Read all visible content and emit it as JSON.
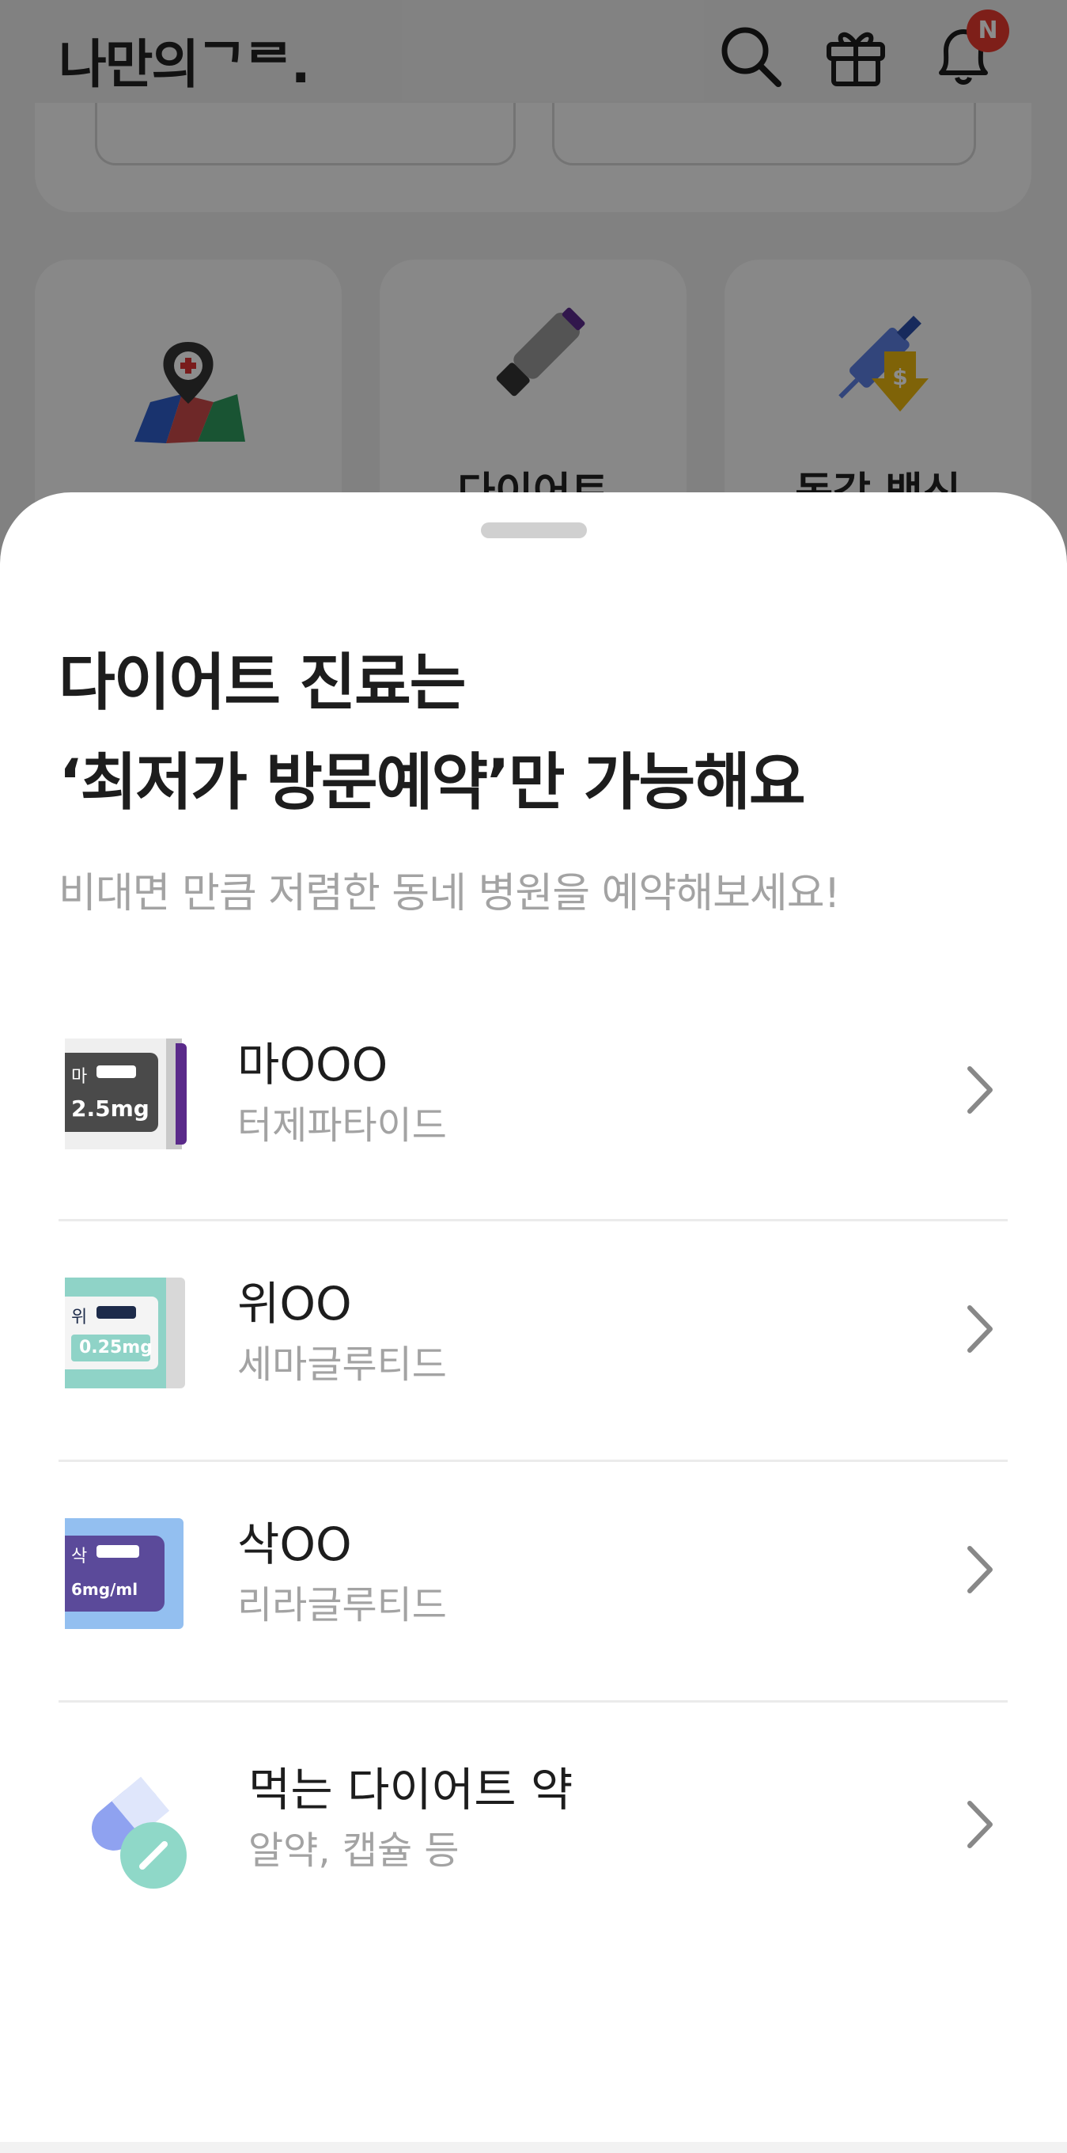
{
  "app": {
    "logo": "나만의ᄀᄅ.",
    "notification_badge": "N",
    "categories": [
      {
        "label": "",
        "icon": "map-hospital-icon"
      },
      {
        "label": "다이어트",
        "icon": "diet-pen-icon"
      },
      {
        "label": "독감 백신",
        "icon": "vaccine-discount-icon"
      }
    ]
  },
  "sheet": {
    "title_line1": "다이어트 진료는",
    "title_line2": "‘최저가 방문예약’만 가능해요",
    "subtitle": "비대면 만큼 저렴한 동네 병원을 예약해보세요!",
    "items": [
      {
        "name": "마OOO",
        "desc": "터제파타이드",
        "thumb_label": "마",
        "thumb_dose": "2.5mg",
        "icon": "mounjaro-box-icon"
      },
      {
        "name": "위OO",
        "desc": "세마글루티드",
        "thumb_label": "위",
        "thumb_dose": "0.25mg",
        "icon": "wegovy-box-icon"
      },
      {
        "name": "삭OO",
        "desc": "리라글루티드",
        "thumb_label": "삭",
        "thumb_dose": "6mg/ml",
        "icon": "saxenda-box-icon"
      },
      {
        "name": "먹는 다이어트 약",
        "desc": "알약, 캡슐 등",
        "icon": "pill-capsule-icon"
      }
    ]
  },
  "colors": {
    "badge": "#e63a2e",
    "mounjaro_accent": "#5a2a8a",
    "wegovy_accent": "#8fd3c7",
    "saxenda_accent": "#5b4a9a",
    "pill_blue": "#8fa2f0",
    "pill_teal": "#8fd8c8"
  }
}
